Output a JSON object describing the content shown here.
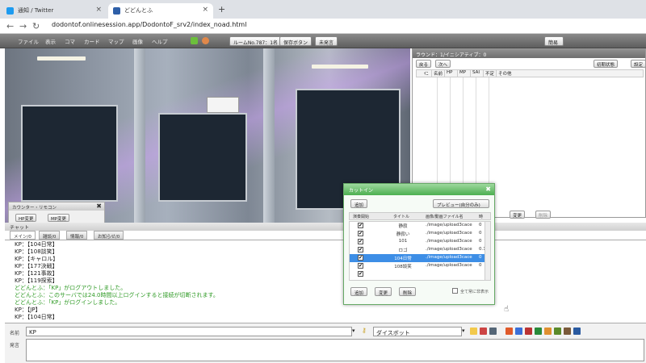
{
  "browser": {
    "tabs": [
      {
        "label": "通知 / Twitter",
        "icon": "twitter-icon",
        "active": false
      },
      {
        "label": "どどんとふ",
        "icon": "dodontof-icon",
        "active": true
      }
    ],
    "new_tab": "+",
    "url": "dodontof.onlinesession.app/DodontoF_srv2/index_noad.html"
  },
  "menubar": {
    "items": [
      "ファイル",
      "表示",
      "コマ",
      "カード",
      "マップ",
      "画像",
      "ヘルプ"
    ],
    "room_label": "ルームNo.787：1名",
    "save_label": "保存ボタン",
    "unread_label": "未発言",
    "right_label": "簡易"
  },
  "round": {
    "title": "ラウンド：1/イニシアティブ：0",
    "back_label": "戻る",
    "next_label": "次へ",
    "reset_label": "初期状態",
    "settings_label": "設定",
    "columns": [
      "ｲﾆ",
      "名前",
      "HP",
      "MP",
      "SAI",
      "不定",
      "その他"
    ],
    "bottom_buttons": [
      "変更",
      "削除"
    ]
  },
  "counter": {
    "title": "カウンター・リモコン",
    "buttons": [
      "HP変更",
      "MP変更"
    ]
  },
  "chat": {
    "header": "チャット",
    "tabs": [
      "メイン/0",
      "雑談/0",
      "情報/0",
      "お知らせ/0"
    ],
    "lines": [
      {
        "text": "KP：【104日常】",
        "sys": false
      },
      {
        "text": "KP：【108談笑】",
        "sys": false
      },
      {
        "text": "KP：【キャロル】",
        "sys": false
      },
      {
        "text": "KP：【177決戦】",
        "sys": false
      },
      {
        "text": "KP：【121事故】",
        "sys": false
      },
      {
        "text": "KP：【119探索】",
        "sys": false
      },
      {
        "text": "どどんとふ：「KP」がログアウトしました。",
        "sys": true
      },
      {
        "text": "どどんとふ：このサーバでは24.0時間以上ログインすると接続が切断されます。",
        "sys": true
      },
      {
        "text": "どどんとふ：「KP」がログインしました。",
        "sys": true
      },
      {
        "text": "KP：【JP】",
        "sys": false
      },
      {
        "text": "KP：【104日常】",
        "sys": false
      }
    ]
  },
  "cutin": {
    "title": "カットイン",
    "add_label": "追加",
    "preview_label": "プレビュー(自分のみ)",
    "columns": [
      "演奏開始",
      "タイトル",
      "画像/動画ファイル名",
      "時"
    ],
    "rows": [
      {
        "title": "静寂",
        "file": "./image/upload3cace",
        "num": "0",
        "checked": true,
        "selected": false
      },
      {
        "title": "静寂い",
        "file": "./image/upload3cace",
        "num": "0",
        "checked": true,
        "selected": false
      },
      {
        "title": "101",
        "file": "./image/upload3cace",
        "num": "0",
        "checked": true,
        "selected": false
      },
      {
        "title": "ロゴ",
        "file": "./image/upload3cace",
        "num": "0.1",
        "checked": true,
        "selected": false
      },
      {
        "title": "104日常",
        "file": "./image/upload3cace",
        "num": "0",
        "checked": true,
        "selected": true
      },
      {
        "title": "108談笑",
        "file": "./image/upload3cace",
        "num": "0",
        "checked": true,
        "selected": false
      },
      {
        "title": "",
        "file": "",
        "num": "",
        "checked": true,
        "selected": false
      }
    ],
    "bottom_buttons": [
      "追加",
      "変更",
      "削除"
    ],
    "hide_all_label": "全て常に非表示"
  },
  "input": {
    "name_label": "名前",
    "name_value": "KP",
    "system_value": "ダイスボット",
    "message_label": "発言"
  },
  "colors": {
    "accent_green": "#4caf50",
    "selected_row": "#3d8ee6",
    "system_text": "#2e9a24"
  }
}
